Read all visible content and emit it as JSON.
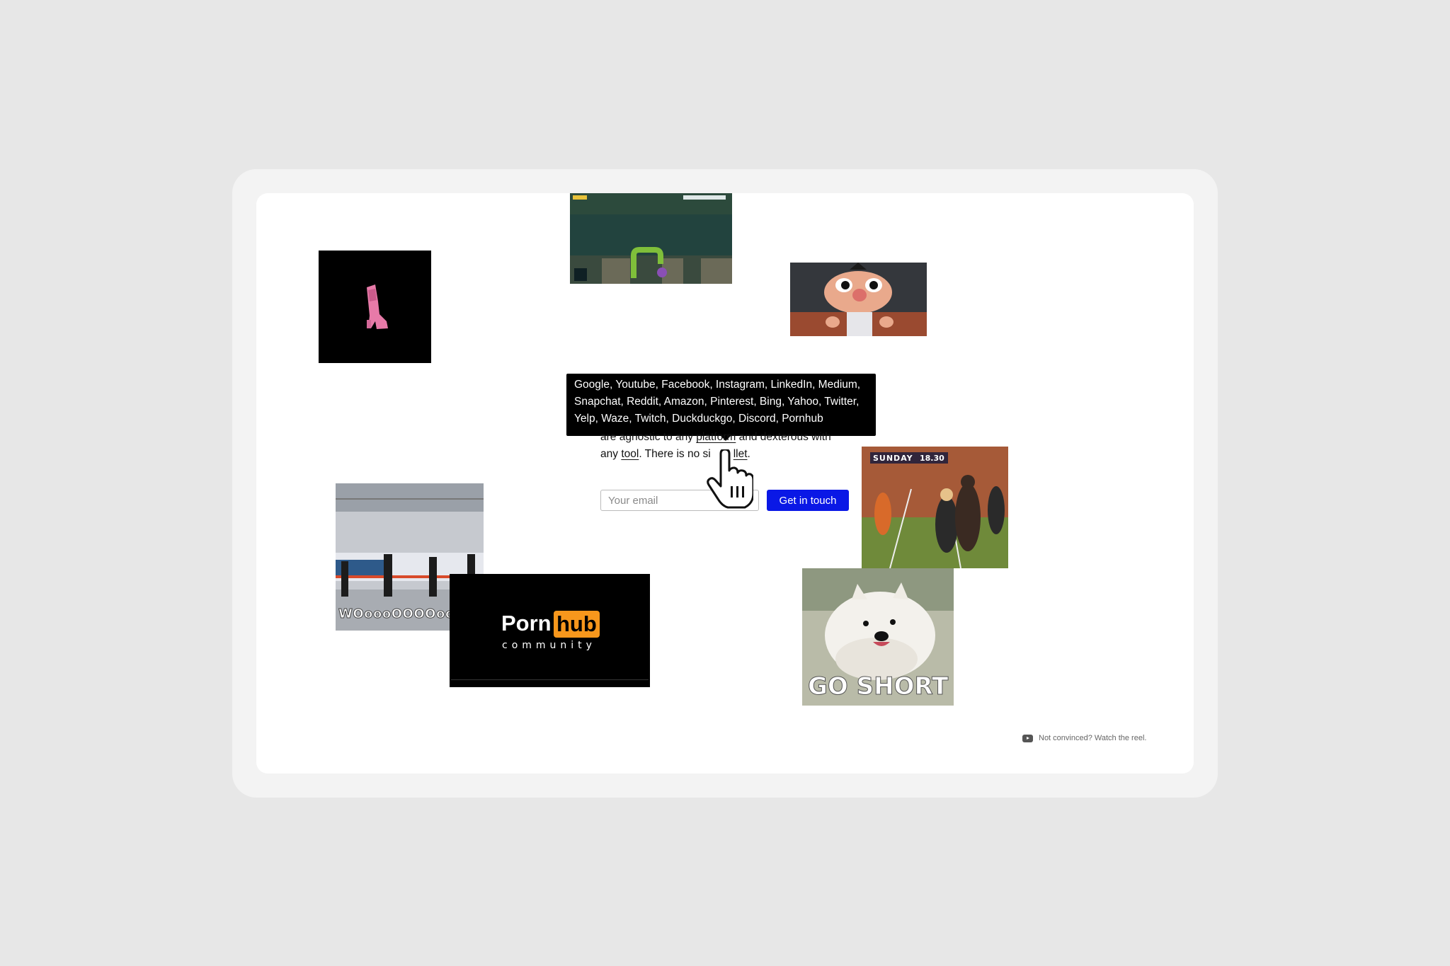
{
  "tooltip": {
    "text": "Google, Youtube, Facebook, Instagram, LinkedIn, Medium, Snapchat, Reddit, Amazon, Pinterest, Bing, Yahoo, Twitter, Yelp, Waze, Twitch, Duckduckgo, Discord, Pornhub"
  },
  "copy": {
    "line1_visible": "are agnostic to any",
    "platform_link": "platform",
    "line1_end": "and dexterous with",
    "line2_start": "any",
    "tool_link": "tool",
    "line2_mid": ". There is no si",
    "bullet_link": "llet",
    "line2_end": "."
  },
  "form": {
    "email_placeholder": "Your email",
    "submit_label": "Get in touch"
  },
  "reel": {
    "label": "Not convinced? Watch the reel."
  },
  "media": {
    "train_caption": "WOoooOOOOooooOO",
    "pornhub_word1": "Porn",
    "pornhub_word2": "hub",
    "pornhub_sub": "community",
    "dog_caption": "GO SHORT",
    "sports_badge_day": "SUNDAY",
    "sports_badge_time": "18.30"
  },
  "colors": {
    "background": "#e7e7e7",
    "frame": "#f3f3f3",
    "cta": "#0a18e6",
    "pornhub_orange": "#f7971c"
  }
}
